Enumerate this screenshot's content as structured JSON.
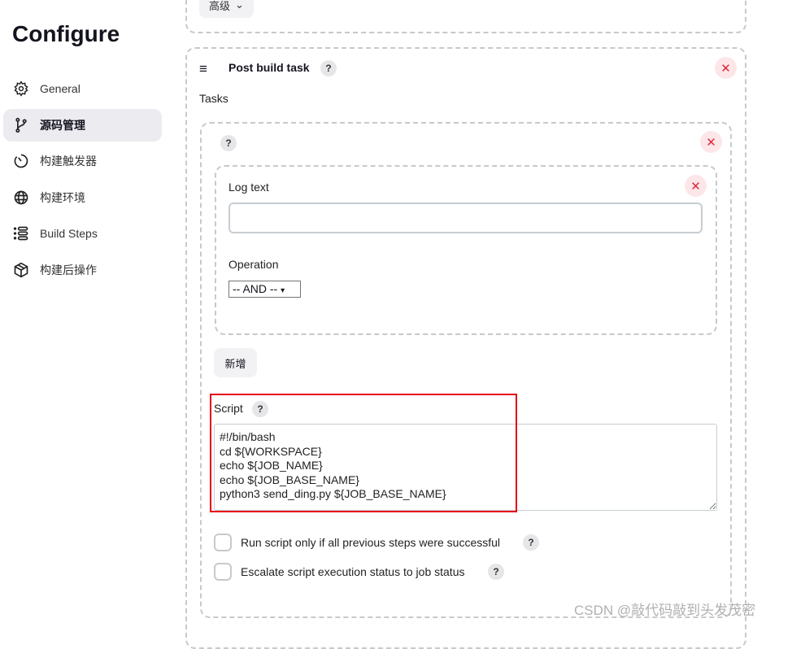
{
  "sidebar": {
    "title": "Configure",
    "items": [
      {
        "label": "General",
        "icon": "gear-icon"
      },
      {
        "label": "源码管理",
        "icon": "branch-icon",
        "active": true
      },
      {
        "label": "构建触发器",
        "icon": "timer-icon"
      },
      {
        "label": "构建环境",
        "icon": "globe-icon"
      },
      {
        "label": "Build Steps",
        "icon": "list-icon"
      },
      {
        "label": "构建后操作",
        "icon": "package-icon"
      }
    ]
  },
  "top": {
    "advanced_label": "高级"
  },
  "post_build": {
    "title": "Post build task",
    "help": "?",
    "tasks_label": "Tasks",
    "close": "✕",
    "task": {
      "help": "?",
      "log_text_label": "Log text",
      "log_text_value": "",
      "operation_label": "Operation",
      "operation_value": "-- AND --",
      "add_label": "新增",
      "script_label": "Script",
      "script_value": "#!/bin/bash\ncd ${WORKSPACE}\necho ${JOB_NAME}\necho ${JOB_BASE_NAME}\npython3 send_ding.py ${JOB_BASE_NAME}",
      "run_only_label": "Run script only if all previous steps were successful",
      "escalate_label": "Escalate script execution status to job status"
    }
  },
  "highlight_color": "#e60012",
  "watermark": "CSDN @敲代码敲到头发茂密"
}
